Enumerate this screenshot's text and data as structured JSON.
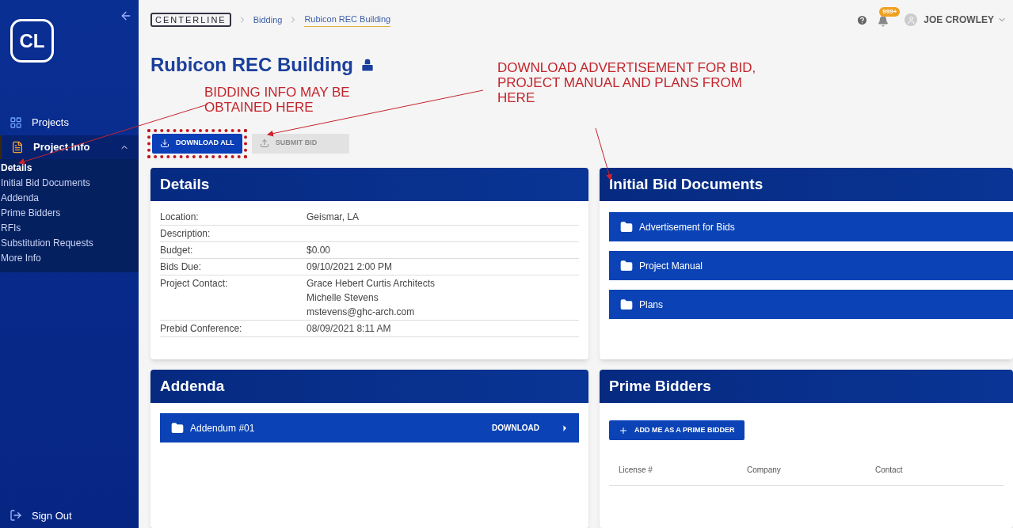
{
  "sidebar": {
    "logo": "CL",
    "items": [
      {
        "kind": "link",
        "label": "Projects"
      },
      {
        "kind": "group",
        "label": "Project Info",
        "expanded": true,
        "children": [
          {
            "label": "Details",
            "selected": true
          },
          {
            "label": "Initial Bid Documents",
            "selected": false
          },
          {
            "label": "Addenda",
            "selected": false
          },
          {
            "label": "Prime Bidders",
            "selected": false
          },
          {
            "label": "RFIs",
            "selected": false
          },
          {
            "label": "Substitution Requests",
            "selected": false
          },
          {
            "label": "More Info",
            "selected": false
          }
        ]
      }
    ],
    "sign_out": "Sign Out"
  },
  "breadcrumb": [
    "CENTERLINE",
    "Bidding",
    "Rubicon REC Building"
  ],
  "header": {
    "badge": "999+",
    "user": "JOE CROWLEY"
  },
  "title": "Rubicon REC Building",
  "actions": [
    {
      "label": "DOWNLOAD ALL",
      "disabled": false
    },
    {
      "label": "SUBMIT BID",
      "disabled": true
    }
  ],
  "details": {
    "title": "Details",
    "rows": [
      {
        "label": "Location:",
        "values": [
          "Geismar, LA"
        ]
      },
      {
        "label": "Description:",
        "values": []
      },
      {
        "label": "Budget:",
        "values": [
          "$0.00"
        ]
      },
      {
        "label": "Bids Due:",
        "values": [
          "09/10/2021 2:00 PM"
        ]
      },
      {
        "label": "Project Contact:",
        "values": [
          "Grace Hebert Curtis Architects",
          "Michelle Stevens",
          "mstevens@ghc-arch.com"
        ]
      },
      {
        "label": "Prebid Conference:",
        "values": [
          "08/09/2021 8:11 AM"
        ]
      }
    ]
  },
  "initial_bid_documents": {
    "title": "Initial Bid Documents",
    "folders": [
      "Advertisement for Bids",
      "Project Manual",
      "Plans"
    ]
  },
  "addenda": {
    "title": "Addenda",
    "items": [
      {
        "name": "Addendum #01",
        "action": "DOWNLOAD"
      }
    ]
  },
  "prime_bidders": {
    "title": "Prime Bidders",
    "button": "ADD ME AS A PRIME BIDDER",
    "columns": [
      "License #",
      "Company",
      "Contact"
    ]
  },
  "annotations": [
    "BIDDING INFO MAY BE OBTAINED HERE",
    "DOWNLOAD ADVERTISEMENT FOR BID, PROJECT MANUAL AND PLANS FROM HERE"
  ]
}
